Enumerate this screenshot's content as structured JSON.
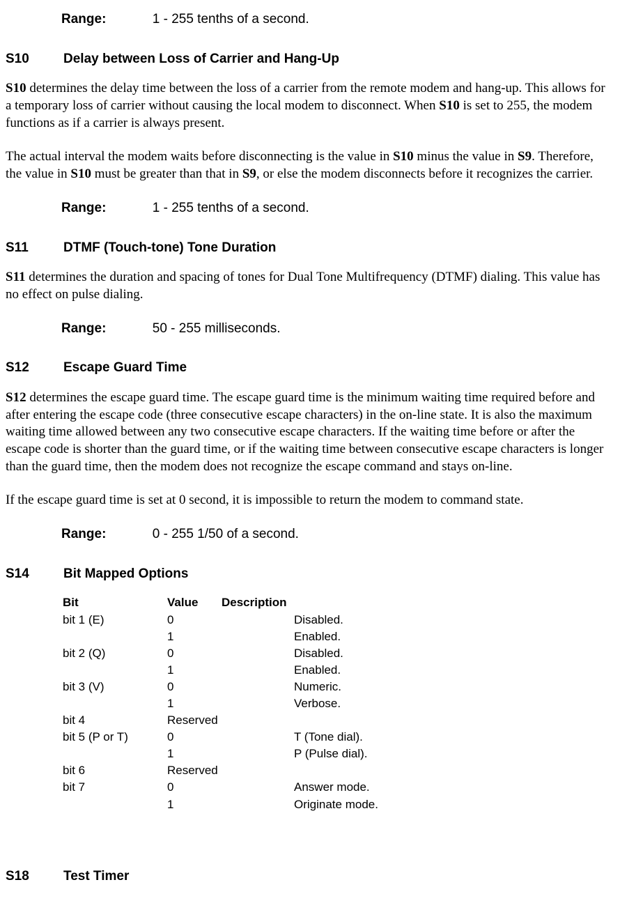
{
  "top_range": {
    "label": "Range:",
    "value": "1 - 255 tenths of a second."
  },
  "s10": {
    "reg": "S10",
    "title": "Delay between Loss of Carrier and Hang-Up",
    "p1_lead_bold": "S10",
    "p1_rest": " determines the delay time between the loss of a carrier from the remote modem and hang-up. This allows for a temporary loss of carrier without causing the local modem to disconnect. When ",
    "p1_bold2": "S10",
    "p1_tail": " is set to 255, the modem functions as if a carrier is always present.",
    "p2_a": "The actual interval the modem waits before disconnecting is the value in ",
    "p2_b1": "S10",
    "p2_b": " minus the value in ",
    "p2_b2": "S9",
    "p2_c": ". Therefore, the value in ",
    "p2_b3": "S10",
    "p2_d": " must be greater than that in ",
    "p2_b4": "S9",
    "p2_e": ", or else the modem disconnects before it recognizes the carrier.",
    "range": {
      "label": "Range:",
      "value": "1 - 255 tenths of a second."
    }
  },
  "s11": {
    "reg": "S11",
    "title": "DTMF (Touch-tone) Tone Duration",
    "p1_lead_bold": "S11",
    "p1_rest": " determines the duration and spacing of tones for Dual Tone Multifrequency (DTMF) dialing. This value has no effect on pulse dialing.",
    "range": {
      "label": "Range:",
      "value": "50 - 255 milliseconds."
    }
  },
  "s12": {
    "reg": "S12",
    "title": "Escape Guard Time",
    "p1_lead_bold": "S12",
    "p1_rest": " determines the escape guard time. The escape guard time is the minimum waiting time required before and after entering the escape code (three consecutive escape characters) in the on-line state. It is also the maximum waiting time allowed between any two consecutive escape characters. If the waiting time before or after the escape code is shorter than the guard time, or if the waiting time between consecutive escape characters is longer than the guard time, then the modem does not recognize the escape command and stays on-line.",
    "p2": "If the escape guard time is set at 0 second, it is impossible to return the modem to command state.",
    "range": {
      "label": "Range:",
      "value": "0 - 255 1/50 of a second."
    }
  },
  "s14": {
    "reg": "S14",
    "title": "Bit Mapped Options",
    "headers": {
      "bit": "Bit",
      "value": "Value",
      "desc": "Description"
    },
    "rows": [
      {
        "bit": "bit 1 (E)",
        "value": "0",
        "desc": "Disabled."
      },
      {
        "bit": "",
        "value": "1",
        "desc": "Enabled."
      },
      {
        "bit": "bit 2 (Q)",
        "value": "0",
        "desc": "Disabled."
      },
      {
        "bit": "",
        "value": "1",
        "desc": "Enabled."
      },
      {
        "bit": "bit 3 (V)",
        "value": "0",
        "desc": "Numeric."
      },
      {
        "bit": "",
        "value": "1",
        "desc": "Verbose."
      },
      {
        "bit": "bit 4",
        "value": "Reserved",
        "desc": ""
      },
      {
        "bit": "bit 5 (P or T)",
        "value": "0",
        "desc": "T (Tone dial)."
      },
      {
        "bit": "",
        "value": "1",
        "desc": "P (Pulse dial)."
      },
      {
        "bit": "bit 6",
        "value": "Reserved",
        "desc": ""
      },
      {
        "bit": "bit 7",
        "value": "0",
        "desc": "Answer mode."
      },
      {
        "bit": "",
        "value": "1",
        "desc": "Originate mode."
      }
    ]
  },
  "s18": {
    "reg": "S18",
    "title": "Test Timer"
  }
}
